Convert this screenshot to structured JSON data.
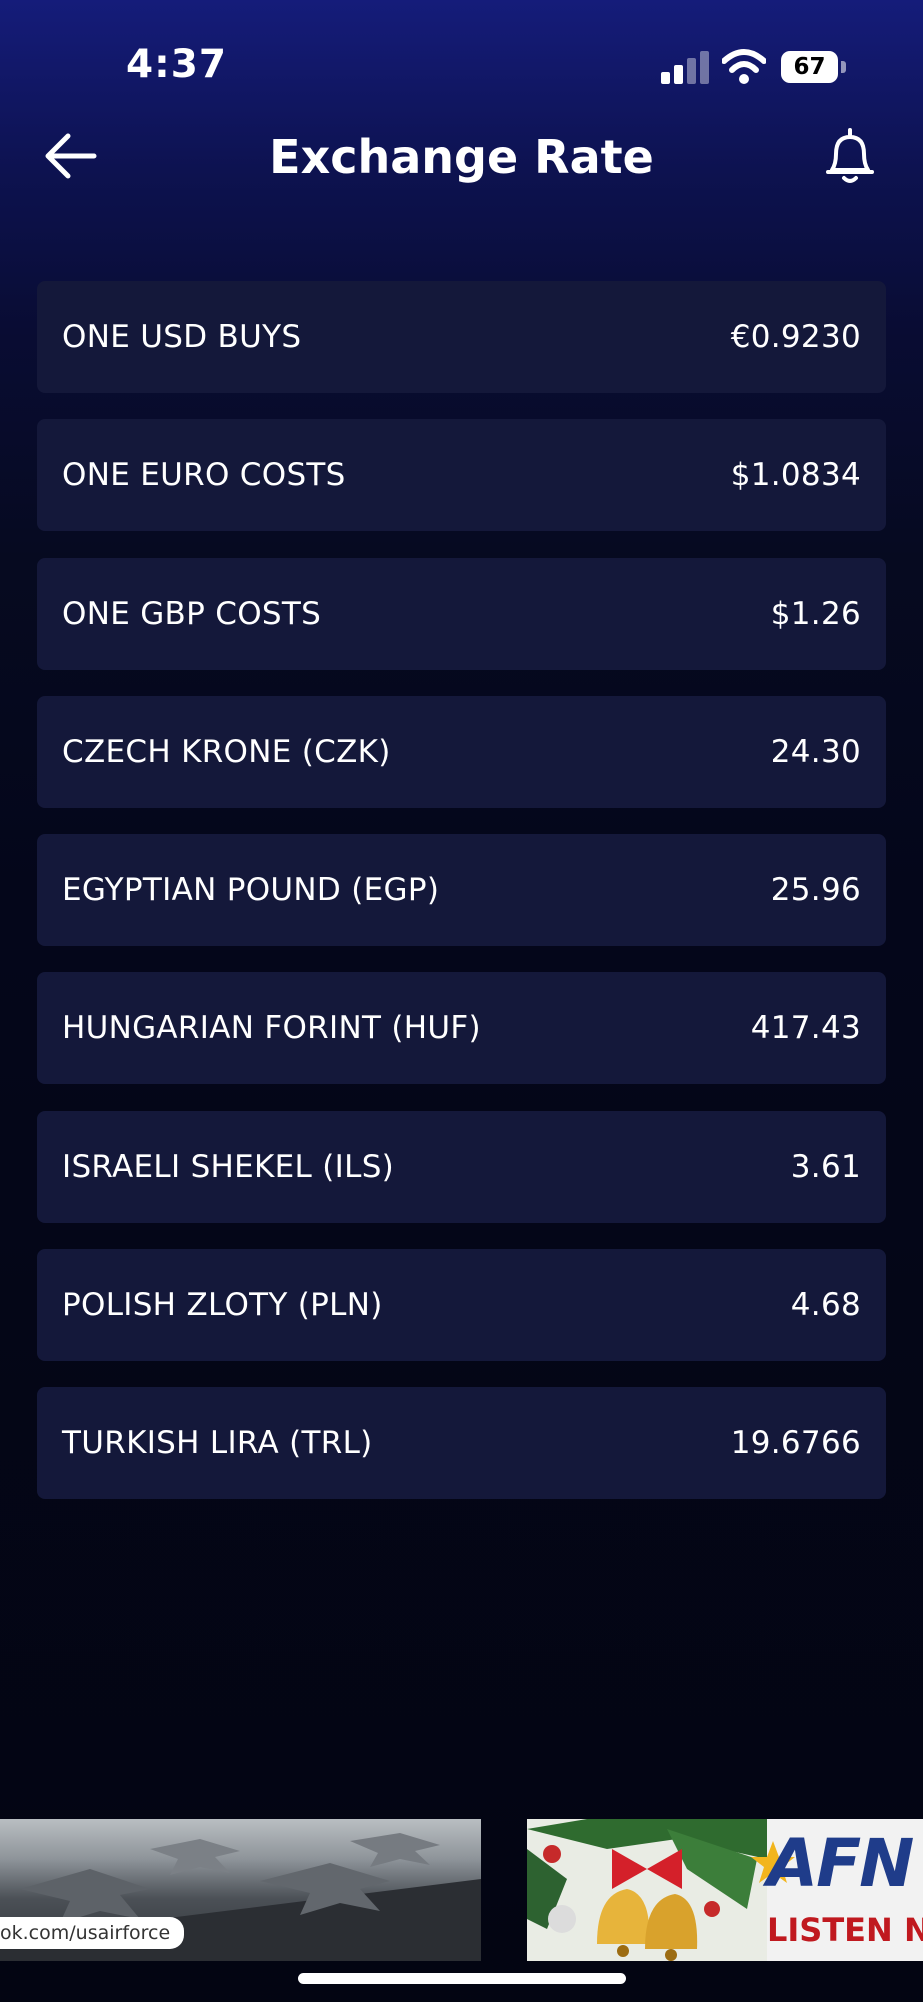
{
  "status_bar": {
    "time": "4:37",
    "battery": "67"
  },
  "header": {
    "title": "Exchange Rate",
    "back_icon": "arrow-left-icon",
    "alert_icon": "bell-icon"
  },
  "rates": [
    {
      "label": "ONE USD BUYS",
      "value": "€0.9230"
    },
    {
      "label": "ONE EURO COSTS",
      "value": "$1.0834"
    },
    {
      "label": "ONE GBP COSTS",
      "value": "$1.26"
    },
    {
      "label": "CZECH KRONE (CZK)",
      "value": "24.30"
    },
    {
      "label": "EGYPTIAN POUND (EGP)",
      "value": "25.96"
    },
    {
      "label": "HUNGARIAN FORINT (HUF)",
      "value": "417.43"
    },
    {
      "label": "ISRAELI SHEKEL (ILS)",
      "value": "3.61"
    },
    {
      "label": "POLISH ZLOTY (PLN)",
      "value": "4.68"
    },
    {
      "label": "TURKISH LIRA (TRL)",
      "value": "19.6766"
    }
  ],
  "ads": {
    "left_url": "ok.com/usairforce",
    "right_logo": "AFN",
    "right_cta": "LISTEN NOW"
  },
  "colors": {
    "background_top": "#151c7a",
    "background_bottom": "#030512",
    "row_background": "#14183a",
    "text": "#ffffff"
  }
}
